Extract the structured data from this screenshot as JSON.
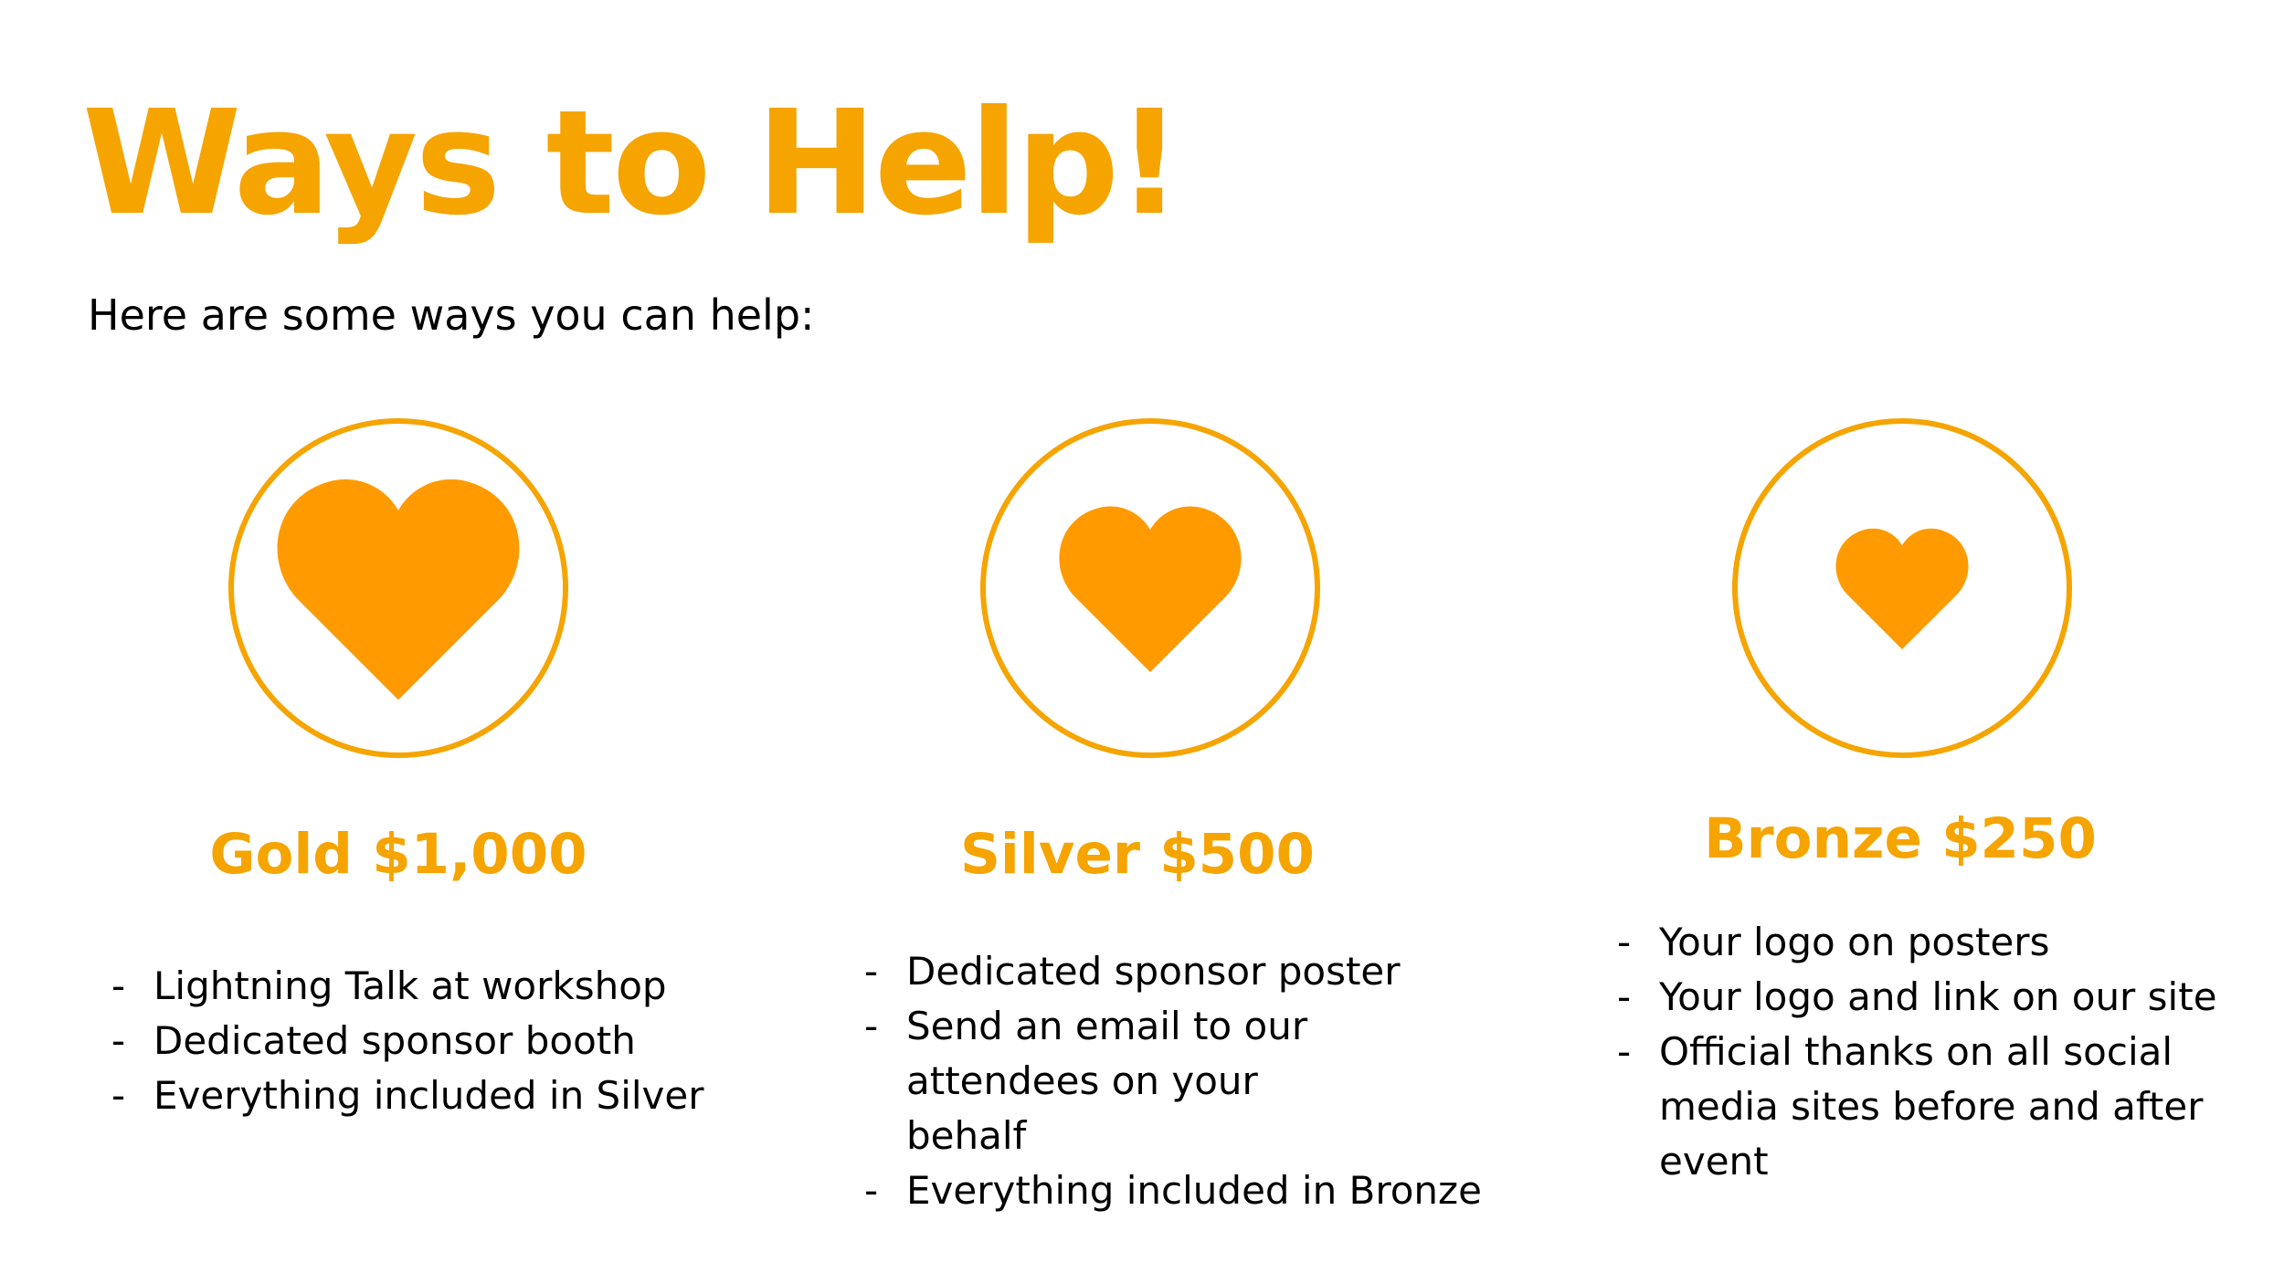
{
  "slide": {
    "title": "Ways to Help!",
    "subtitle": "Here are some ways you can help:",
    "accent_color": "#F5A400",
    "heart_color": "#FF9A00"
  },
  "tiers": [
    {
      "name": "Gold $1,000",
      "icon": "heart-icon",
      "perks": [
        "Lightning Talk at workshop",
        "Dedicated sponsor booth",
        "Everything  included in Silver"
      ]
    },
    {
      "name": "Silver $500",
      "icon": "heart-icon",
      "perks": [
        "Dedicated sponsor poster",
        "Send an email to our attendees on your behalf",
        "Everything included in Bronze"
      ]
    },
    {
      "name": "Bronze $250",
      "icon": "heart-icon",
      "perks": [
        "Your logo on posters",
        "Your logo and link on our site",
        "Official thanks on all social media sites before and after event"
      ]
    }
  ],
  "bullet": "-"
}
